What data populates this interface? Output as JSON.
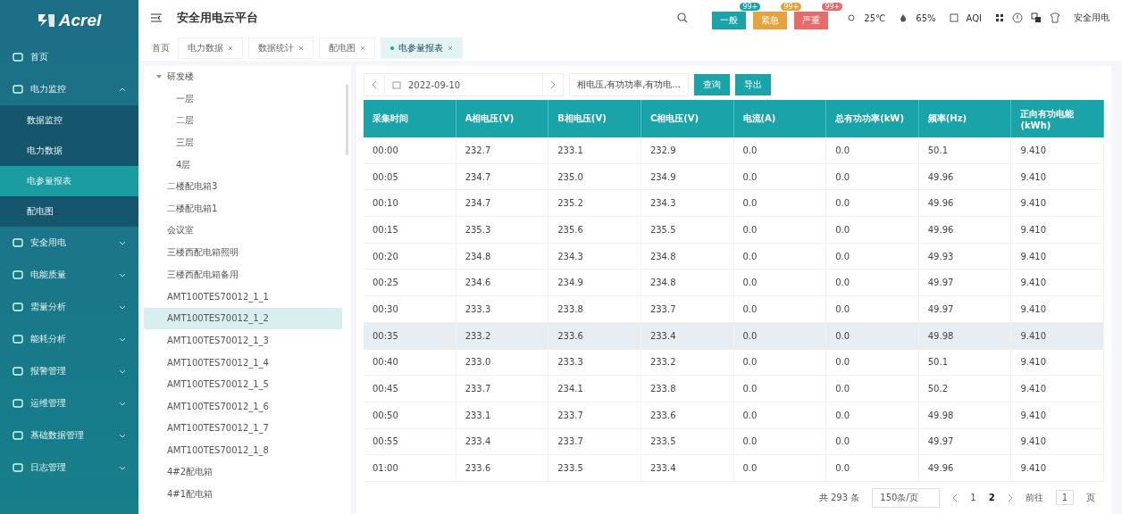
{
  "logo": "Acrel",
  "sidebar": {
    "items": [
      {
        "label": "首页",
        "expandable": false
      },
      {
        "label": "电力监控",
        "expandable": true,
        "expanded": true,
        "children": [
          {
            "label": "数据监控",
            "selected": false
          },
          {
            "label": "电力数据",
            "selected": false
          },
          {
            "label": "电参量报表",
            "selected": true
          },
          {
            "label": "配电图",
            "selected": false
          }
        ]
      },
      {
        "label": "安全用电",
        "expandable": true,
        "expanded": false
      },
      {
        "label": "电能质量",
        "expandable": true,
        "expanded": false
      },
      {
        "label": "需量分析",
        "expandable": true,
        "expanded": false
      },
      {
        "label": "能耗分析",
        "expandable": true,
        "expanded": false
      },
      {
        "label": "报警管理",
        "expandable": true,
        "expanded": false
      },
      {
        "label": "运维管理",
        "expandable": true,
        "expanded": false
      },
      {
        "label": "基础数据管理",
        "expandable": true,
        "expanded": false
      },
      {
        "label": "日志管理",
        "expandable": true,
        "expanded": false
      }
    ]
  },
  "header": {
    "title": "安全用电云平台",
    "alarms": [
      {
        "label": "一般",
        "count": "99+",
        "color": "#1aa3a8"
      },
      {
        "label": "紧急",
        "count": "99+",
        "color": "#e6a23c"
      },
      {
        "label": "严重",
        "count": "99+",
        "color": "#e86a6a"
      }
    ],
    "temperature": "25℃",
    "humidity": "65%",
    "weather": "AQI",
    "user": "安全用电"
  },
  "tabs": [
    {
      "label": "首页",
      "selected": false,
      "closable": false
    },
    {
      "label": "电力数据",
      "selected": false,
      "closable": true
    },
    {
      "label": "数据统计",
      "selected": false,
      "closable": true
    },
    {
      "label": "配电图",
      "selected": false,
      "closable": true
    },
    {
      "label": "电参量报表",
      "selected": true,
      "closable": true
    }
  ],
  "tree": [
    {
      "label": "研发楼",
      "expanded": true,
      "selected": false,
      "children": [
        {
          "label": "一层",
          "selected": false
        },
        {
          "label": "二层",
          "selected": false
        },
        {
          "label": "三层",
          "selected": false
        },
        {
          "label": "4层",
          "selected": false
        }
      ]
    },
    {
      "label": "二楼配电箱3",
      "selected": false
    },
    {
      "label": "二楼配电箱1",
      "selected": false
    },
    {
      "label": "会议室",
      "selected": false
    },
    {
      "label": "三楼西配电箱照明",
      "selected": false
    },
    {
      "label": "三楼西配电箱备用",
      "selected": false
    },
    {
      "label": "AMT100TES70012_1_1",
      "selected": false
    },
    {
      "label": "AMT100TES70012_1_2",
      "selected": true
    },
    {
      "label": "AMT100TES70012_1_3",
      "selected": false
    },
    {
      "label": "AMT100TES70012_1_4",
      "selected": false
    },
    {
      "label": "AMT100TES70012_1_5",
      "selected": false
    },
    {
      "label": "AMT100TES70012_1_6",
      "selected": false
    },
    {
      "label": "AMT100TES70012_1_7",
      "selected": false
    },
    {
      "label": "AMT100TES70012_1_8",
      "selected": false
    },
    {
      "label": "4#2配电箱",
      "selected": false
    },
    {
      "label": "4#1配电箱",
      "selected": false
    }
  ],
  "filters": {
    "date": "2022-09-10",
    "params": "相电压,有功功率,有功电...",
    "query_button": "查询",
    "export_button": "导出"
  },
  "table": {
    "columns": [
      "采集时间",
      "A相电压(V)",
      "B相电压(V)",
      "C相电压(V)",
      "电流(A)",
      "总有功功率(kW)",
      "频率(Hz)",
      "正向有功电能(kWh)"
    ],
    "rows": [
      {
        "cells": [
          "00:00",
          "232.7",
          "233.1",
          "232.9",
          "0.0",
          "0.0",
          "50.1",
          "9.410"
        ],
        "highlighted": false
      },
      {
        "cells": [
          "00:05",
          "234.7",
          "235.0",
          "234.9",
          "0.0",
          "0.0",
          "49.96",
          "9.410"
        ],
        "highlighted": false
      },
      {
        "cells": [
          "00:10",
          "234.7",
          "235.2",
          "234.3",
          "0.0",
          "0.0",
          "49.96",
          "9.410"
        ],
        "highlighted": false
      },
      {
        "cells": [
          "00:15",
          "235.3",
          "235.6",
          "235.5",
          "0.0",
          "0.0",
          "49.96",
          "9.410"
        ],
        "highlighted": false
      },
      {
        "cells": [
          "00:20",
          "234.8",
          "234.3",
          "234.8",
          "0.0",
          "0.0",
          "49.93",
          "9.410"
        ],
        "highlighted": false
      },
      {
        "cells": [
          "00:25",
          "234.6",
          "234.9",
          "234.8",
          "0.0",
          "0.0",
          "49.97",
          "9.410"
        ],
        "highlighted": false
      },
      {
        "cells": [
          "00:30",
          "233.3",
          "233.8",
          "233.7",
          "0.0",
          "0.0",
          "49.97",
          "9.410"
        ],
        "highlighted": false
      },
      {
        "cells": [
          "00:35",
          "233.2",
          "233.6",
          "233.4",
          "0.0",
          "0.0",
          "49.98",
          "9.410"
        ],
        "highlighted": true
      },
      {
        "cells": [
          "00:40",
          "233.0",
          "233.3",
          "233.2",
          "0.0",
          "0.0",
          "50.1",
          "9.410"
        ],
        "highlighted": false
      },
      {
        "cells": [
          "00:45",
          "233.7",
          "234.1",
          "233.8",
          "0.0",
          "0.0",
          "50.2",
          "9.410"
        ],
        "highlighted": false
      },
      {
        "cells": [
          "00:50",
          "233.1",
          "233.7",
          "233.6",
          "0.0",
          "0.0",
          "49.98",
          "9.410"
        ],
        "highlighted": false
      },
      {
        "cells": [
          "00:55",
          "233.4",
          "233.7",
          "233.5",
          "0.0",
          "0.0",
          "49.97",
          "9.410"
        ],
        "highlighted": false
      },
      {
        "cells": [
          "01:00",
          "233.6",
          "233.5",
          "233.4",
          "0.0",
          "0.0",
          "49.96",
          "9.410"
        ],
        "highlighted": false
      }
    ]
  },
  "pagination": {
    "total": "共 293 条",
    "page_size": "150条/页",
    "pages": [
      {
        "label": "1",
        "selected": false
      },
      {
        "label": "2",
        "selected": true
      }
    ],
    "goto_label": "前往",
    "goto_value": "1",
    "goto_suffix": "页"
  }
}
